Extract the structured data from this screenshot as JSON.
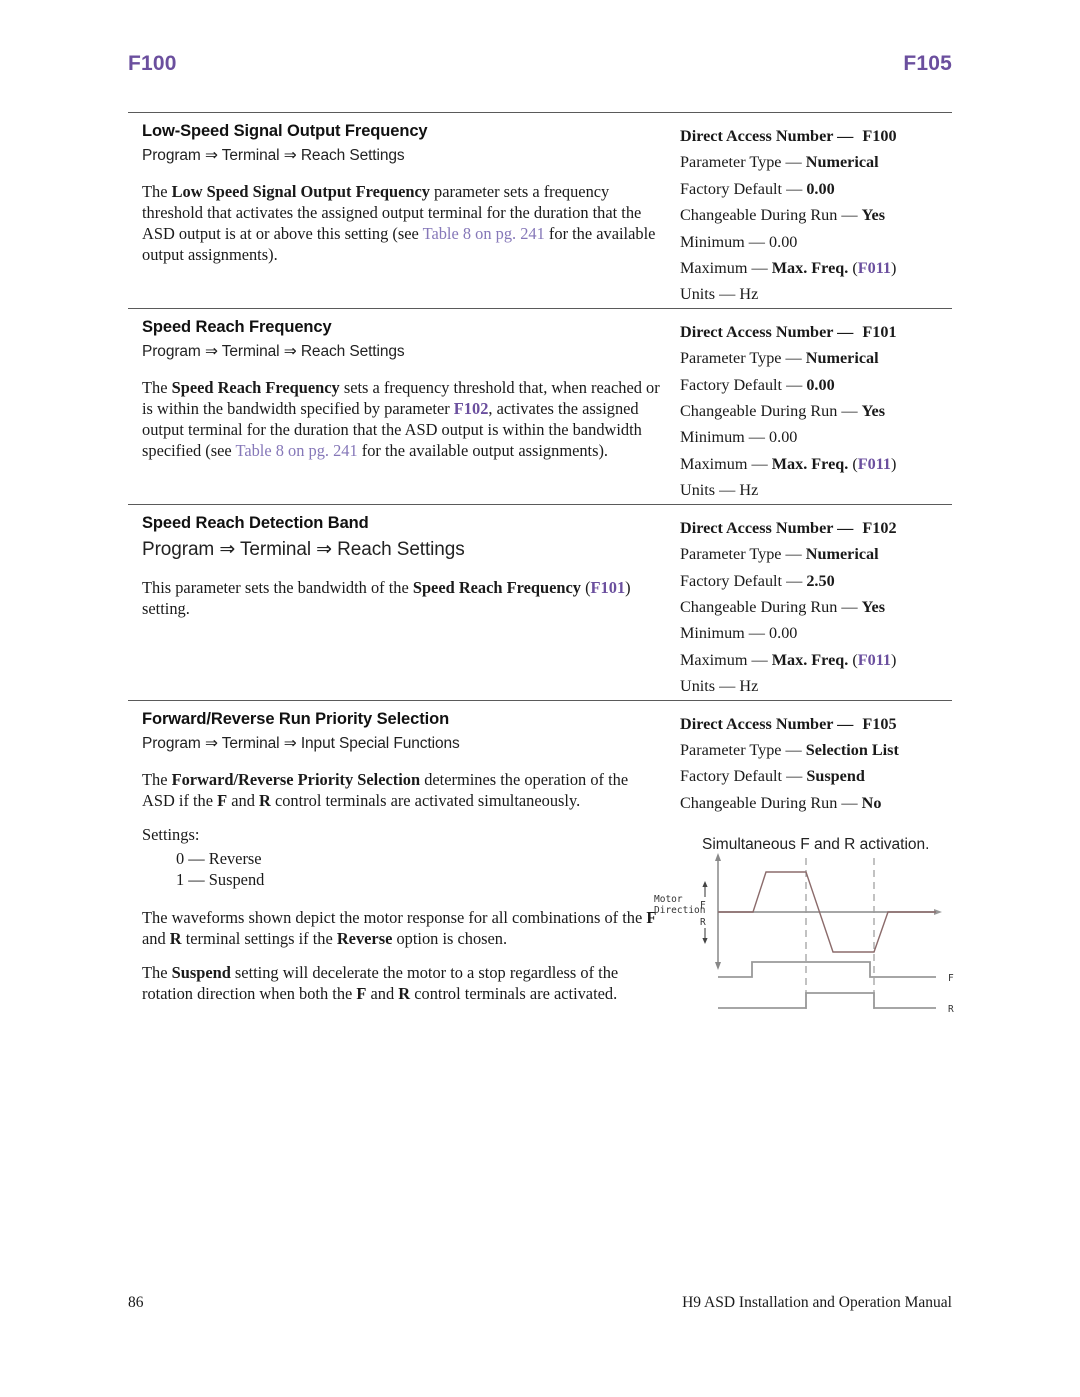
{
  "runhead": {
    "left": "F100",
    "right": "F105"
  },
  "colors": {
    "heading_purple": "#6b4f9e",
    "xref_purple": "#8577b8"
  },
  "sections": [
    {
      "title": "Low-Speed Signal Output Frequency",
      "navpath": "Program ⇒ Terminal ⇒ Reach Settings",
      "body_parts": [
        {
          "text": "The ",
          "style": "normal"
        },
        {
          "text": "Low Speed Signal Output Frequency",
          "style": "bold"
        },
        {
          "text": " parameter sets a frequency threshold that activates the assigned output terminal for the duration that the ASD output is at or above this setting (see ",
          "style": "normal"
        },
        {
          "text": "Table 8 on pg. 241",
          "style": "xref"
        },
        {
          "text": " for the available output assignments).",
          "style": "normal"
        }
      ],
      "spec": {
        "direct_access_label": "Direct Access Number —",
        "direct_access_value": "F100",
        "parameter_type_label": "Parameter Type —",
        "parameter_type_value": "Numerical",
        "factory_default_label": "Factory Default —",
        "factory_default_value": "0.00",
        "changeable_label": "Changeable During Run —",
        "changeable_value": "Yes",
        "minimum_label": "Minimum —",
        "minimum_value": "0.00",
        "maximum_label": "Maximum —",
        "maximum_value": "Max. Freq.",
        "maximum_ref": "F011",
        "units_label": "Units —",
        "units_value": "Hz"
      }
    },
    {
      "title": "Speed Reach Frequency",
      "navpath": "Program ⇒ Terminal ⇒ Reach Settings",
      "body_parts": [
        {
          "text": "The ",
          "style": "normal"
        },
        {
          "text": "Speed Reach Frequency",
          "style": "bold"
        },
        {
          "text": " sets a frequency threshold that, when reached or is within the bandwidth specified by parameter ",
          "style": "normal"
        },
        {
          "text": "F102",
          "style": "pref"
        },
        {
          "text": ", activates the assigned output terminal for the duration that the ASD output is within the bandwidth specified (see ",
          "style": "normal"
        },
        {
          "text": "Table 8 on pg. 241",
          "style": "xref"
        },
        {
          "text": " for the available output assignments).",
          "style": "normal"
        }
      ],
      "spec": {
        "direct_access_label": "Direct Access Number —",
        "direct_access_value": "F101",
        "parameter_type_label": "Parameter Type —",
        "parameter_type_value": "Numerical",
        "factory_default_label": "Factory Default —",
        "factory_default_value": "0.00",
        "changeable_label": "Changeable During Run —",
        "changeable_value": "Yes",
        "minimum_label": "Minimum —",
        "minimum_value": "0.00",
        "maximum_label": "Maximum —",
        "maximum_value": "Max. Freq.",
        "maximum_ref": "F011",
        "units_label": "Units —",
        "units_value": "Hz"
      }
    },
    {
      "title": "Speed Reach Detection Band",
      "navpath": "Program ⇒ Terminal ⇒ Reach Settings",
      "body_parts": [
        {
          "text": "This parameter sets the bandwidth of the ",
          "style": "normal"
        },
        {
          "text": "Speed Reach Frequency",
          "style": "bold"
        },
        {
          "text": " (",
          "style": "normal"
        },
        {
          "text": "F101",
          "style": "pref"
        },
        {
          "text": ") setting.",
          "style": "normal"
        }
      ],
      "spec": {
        "direct_access_label": "Direct Access Number —",
        "direct_access_value": "F102",
        "parameter_type_label": "Parameter Type —",
        "parameter_type_value": "Numerical",
        "factory_default_label": "Factory Default —",
        "factory_default_value": "2.50",
        "changeable_label": "Changeable During Run —",
        "changeable_value": "Yes",
        "minimum_label": "Minimum —",
        "minimum_value": "0.00",
        "maximum_label": "Maximum —",
        "maximum_value": "Max. Freq.",
        "maximum_ref": "F011",
        "units_label": "Units —",
        "units_value": "Hz"
      }
    },
    {
      "title": "Forward/Reverse Run Priority Selection",
      "navpath": "Program ⇒ Terminal ⇒ Input Special Functions",
      "body_parts": [
        {
          "text": "The ",
          "style": "normal"
        },
        {
          "text": "Forward/Reverse Priority Selection",
          "style": "bold"
        },
        {
          "text": " determines the operation of the ASD if the ",
          "style": "normal"
        },
        {
          "text": "F",
          "style": "bold"
        },
        {
          "text": " and ",
          "style": "normal"
        },
        {
          "text": "R",
          "style": "bold"
        },
        {
          "text": " control terminals are activated simultaneously.",
          "style": "normal"
        }
      ],
      "settings_label": "Settings:",
      "settings_list": [
        "0 — Reverse",
        "1 — Suspend"
      ],
      "extra_paras": [
        [
          {
            "text": "The waveforms shown depict the motor response for all combinations of the ",
            "style": "normal"
          },
          {
            "text": "F",
            "style": "bold"
          },
          {
            "text": " and ",
            "style": "normal"
          },
          {
            "text": "R",
            "style": "bold"
          },
          {
            "text": " terminal settings if the ",
            "style": "normal"
          },
          {
            "text": "Reverse",
            "style": "bold"
          },
          {
            "text": " option is chosen.",
            "style": "normal"
          }
        ],
        [
          {
            "text": "The ",
            "style": "normal"
          },
          {
            "text": "Suspend",
            "style": "bold"
          },
          {
            "text": " setting will decelerate the motor to a stop regardless of the rotation direction when both the ",
            "style": "normal"
          },
          {
            "text": "F",
            "style": "bold"
          },
          {
            "text": " and ",
            "style": "normal"
          },
          {
            "text": "R",
            "style": "bold"
          },
          {
            "text": " control terminals are activated.",
            "style": "normal"
          }
        ]
      ],
      "spec": {
        "direct_access_label": "Direct Access Number —",
        "direct_access_value": "F105",
        "parameter_type_label": "Parameter Type —",
        "parameter_type_value": "Selection List",
        "factory_default_label": "Factory Default —",
        "factory_default_value": "Suspend",
        "changeable_label": "Changeable During Run —",
        "changeable_value": "No"
      },
      "caption": "Simultaneous F and R activation."
    }
  ],
  "diagram": {
    "axis_label_line1": "Motor",
    "axis_label_line2": "Direction",
    "forward_mark": "F",
    "reverse_mark": "R",
    "trace_f_label": "F",
    "trace_r_label": "R"
  },
  "footer": {
    "page_number": "86",
    "manual_title": "H9 ASD Installation and Operation Manual"
  }
}
